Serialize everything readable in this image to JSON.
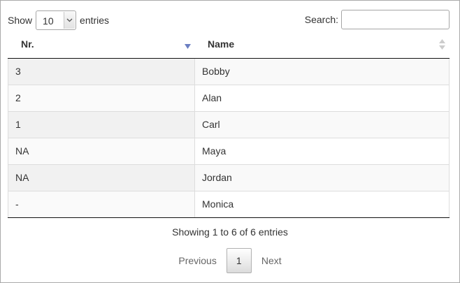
{
  "length": {
    "show_label": "Show",
    "selected": "10",
    "entries_label": "entries"
  },
  "search": {
    "label": "Search:",
    "value": ""
  },
  "table": {
    "columns": [
      "Nr.",
      "Name"
    ],
    "rows": [
      [
        "3",
        "Bobby"
      ],
      [
        "2",
        "Alan"
      ],
      [
        "1",
        "Carl"
      ],
      [
        "NA",
        "Maya"
      ],
      [
        "NA",
        "Jordan"
      ],
      [
        "-",
        "Monica"
      ]
    ]
  },
  "info": "Showing 1 to 6 of 6 entries",
  "pagination": {
    "previous": "Previous",
    "current": "1",
    "next": "Next"
  },
  "colors": {
    "sort_active": "#6b7fc2",
    "sort_inactive": "#cccccc"
  }
}
